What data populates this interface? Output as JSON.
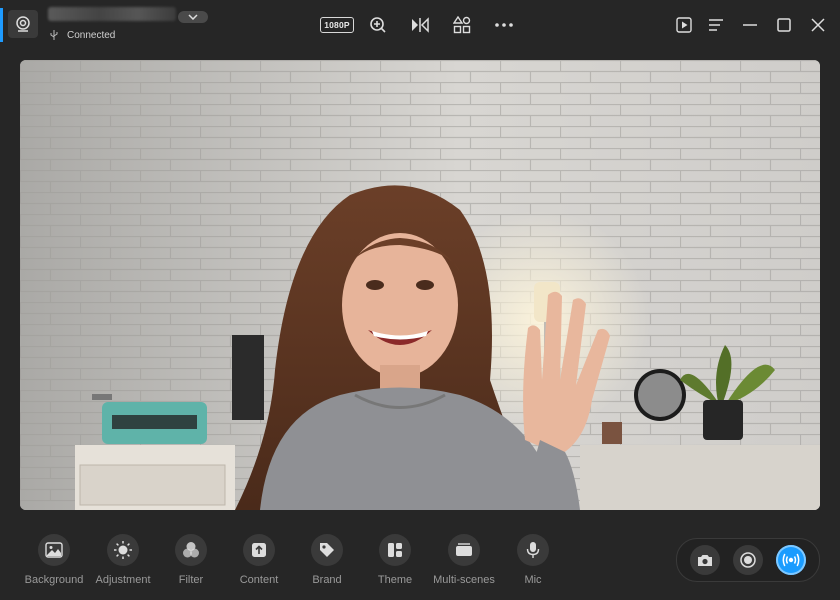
{
  "app": {
    "device_status": "Connected"
  },
  "toolbar": {
    "resolution_label": "1080P",
    "icons": [
      "zoom-in-icon",
      "mirror-icon",
      "apps-icon",
      "more-icon"
    ]
  },
  "window_controls": [
    "play-icon",
    "menu-icon",
    "minimize-icon",
    "maximize-icon",
    "close-icon"
  ],
  "bottom_tools": [
    {
      "label": "Background",
      "icon": "image-icon"
    },
    {
      "label": "Adjustment",
      "icon": "brightness-icon"
    },
    {
      "label": "Filter",
      "icon": "filter-icon"
    },
    {
      "label": "Content",
      "icon": "upload-icon"
    },
    {
      "label": "Brand",
      "icon": "tag-icon"
    },
    {
      "label": "Theme",
      "icon": "theme-icon"
    },
    {
      "label": "Multi-scenes",
      "icon": "scenes-icon"
    },
    {
      "label": "Mic",
      "icon": "mic-icon"
    }
  ],
  "capture": [
    "camera-icon",
    "record-icon",
    "live-icon"
  ],
  "colors": {
    "accent": "#1a9cff",
    "background": "#262626",
    "tool_bg": "#3a3a3a"
  }
}
